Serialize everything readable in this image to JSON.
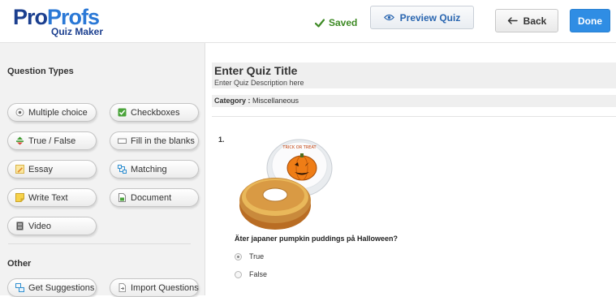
{
  "header": {
    "logo_pro": "Pro",
    "logo_profs": "Profs",
    "logo_sub": "Quiz Maker",
    "saved_label": "Saved",
    "preview_label": "Preview Quiz",
    "back_label": "Back",
    "done_label": "Done"
  },
  "sidebar": {
    "question_types_title": "Question Types",
    "types": [
      {
        "label": "Multiple choice",
        "icon": "radio-icon"
      },
      {
        "label": "Checkboxes",
        "icon": "checkbox-icon"
      },
      {
        "label": "True / False",
        "icon": "true-false-icon"
      },
      {
        "label": "Fill in the blanks",
        "icon": "blank-field-icon"
      },
      {
        "label": "Essay",
        "icon": "pencil-icon"
      },
      {
        "label": "Matching",
        "icon": "matching-icon"
      },
      {
        "label": "Write Text",
        "icon": "note-icon"
      },
      {
        "label": "Document",
        "icon": "document-icon"
      },
      {
        "label": "Video",
        "icon": "film-icon"
      }
    ],
    "other_title": "Other",
    "other": [
      {
        "label": "Get Suggestions",
        "icon": "suggestions-icon"
      },
      {
        "label": "Import Questions",
        "icon": "import-icon"
      }
    ]
  },
  "main": {
    "quiz_title": "Enter Quiz Title",
    "quiz_description": "Enter Quiz Description here",
    "category_label": "Category :",
    "category_value": "Miscellaneous",
    "question": {
      "number": "1.",
      "text": "Äter japaner pumpkin puddings på Halloween?",
      "image_caption": "TRICK OR TREAT",
      "options": [
        {
          "label": "True",
          "selected": true
        },
        {
          "label": "False",
          "selected": false
        }
      ]
    }
  },
  "colors": {
    "brand_dark": "#1b3f8f",
    "brand_light": "#2a78d6",
    "saved_green": "#3d8a24",
    "done_blue": "#2f8de4"
  }
}
